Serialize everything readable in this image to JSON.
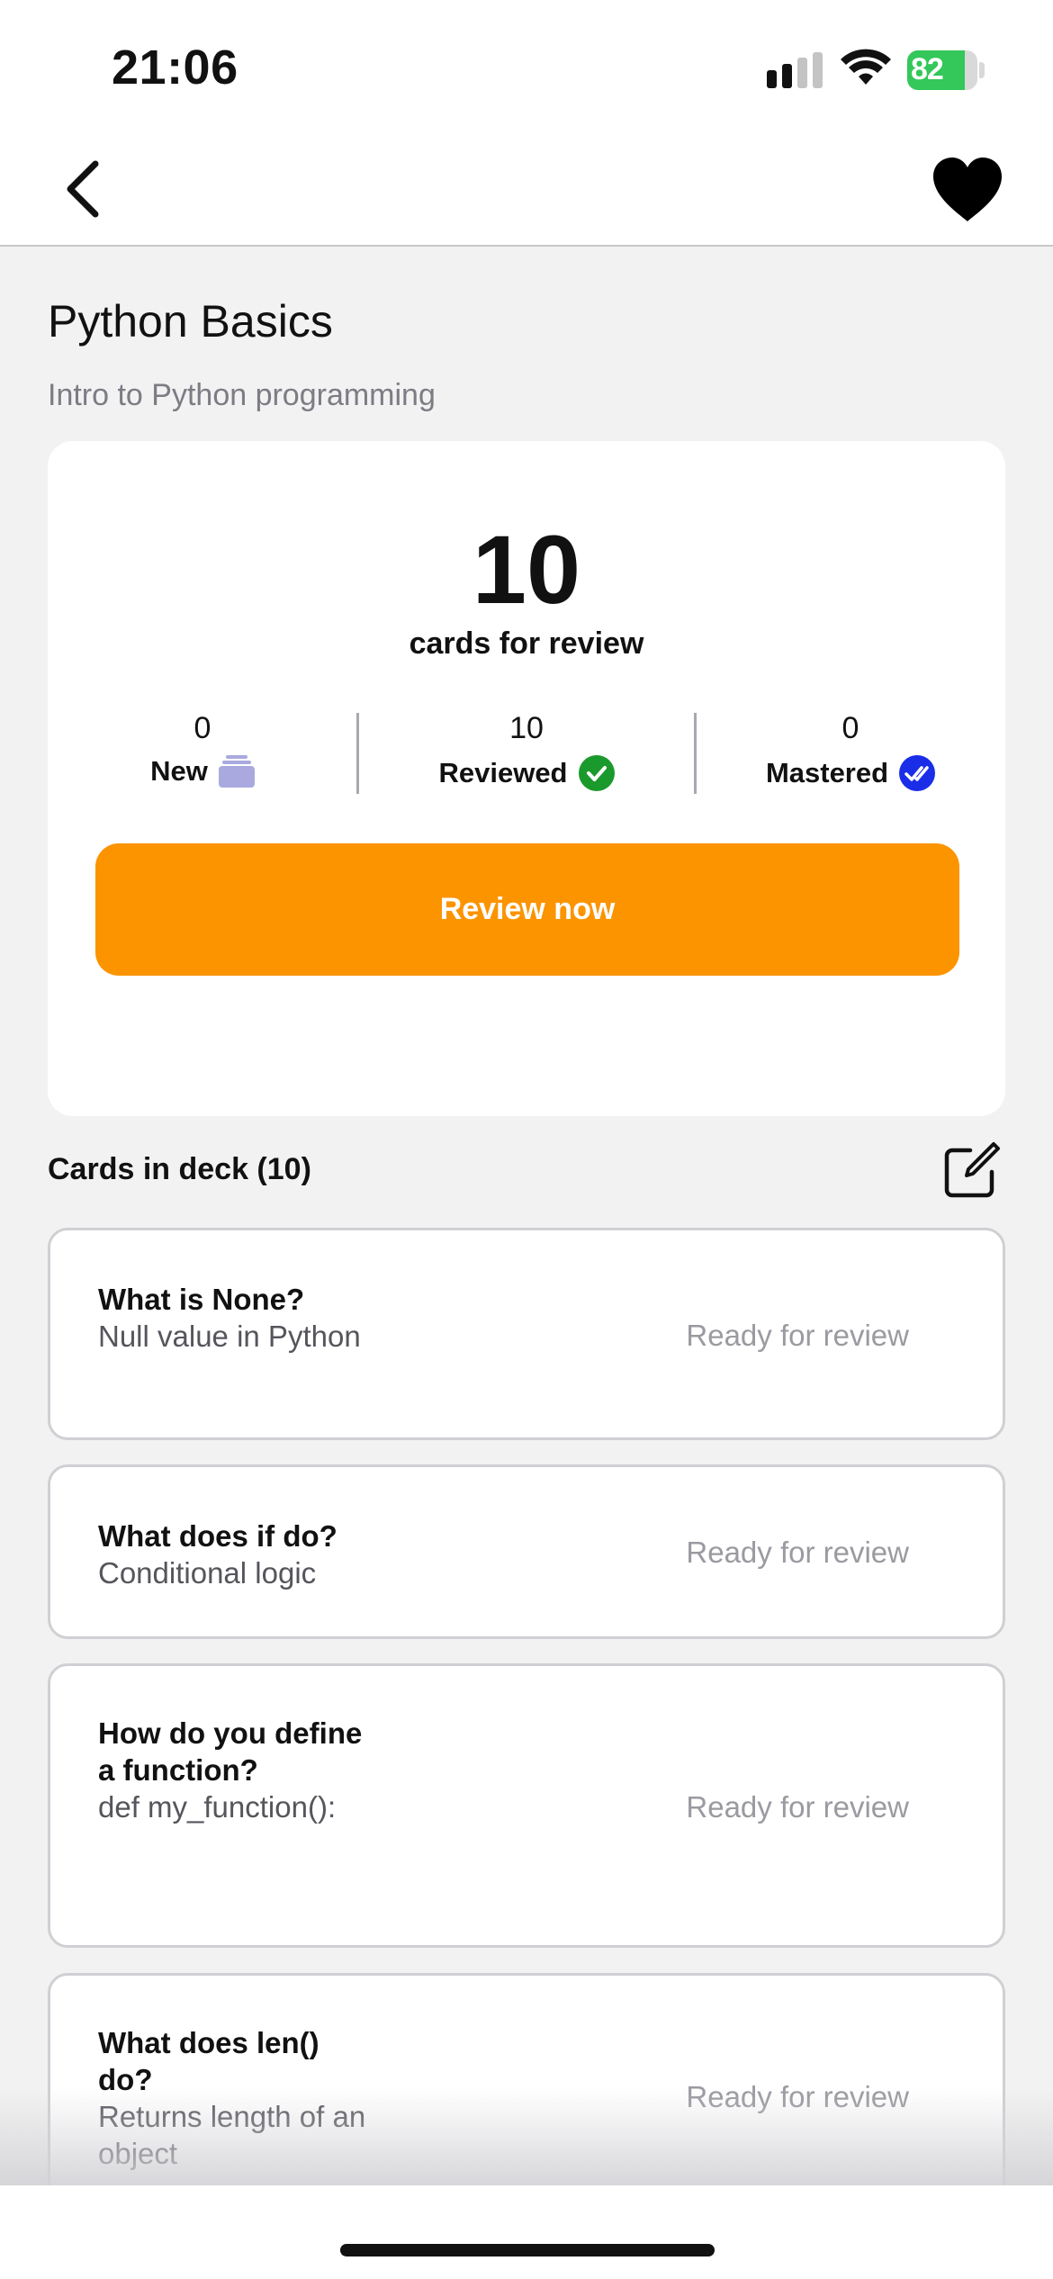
{
  "status_bar": {
    "time": "21:06",
    "battery_percent": "82",
    "battery_level": 0.82,
    "battery_color": "#34c759",
    "icons": [
      "signal-icon",
      "wifi-icon",
      "battery-charging-icon"
    ]
  },
  "nav": {
    "back_icon": "chevron-left-icon",
    "favorite_icon": "heart-filled-icon"
  },
  "deck": {
    "title": "Python Basics",
    "subtitle": "Intro to Python programming"
  },
  "summary": {
    "review_count": "10",
    "review_label": "cards for review",
    "stats": [
      {
        "value": "0",
        "label": "New",
        "icon": "card-stack-icon",
        "icon_color": "#a9a9e0"
      },
      {
        "value": "10",
        "label": "Reviewed",
        "icon": "check-circle-icon",
        "icon_color": "#1a9a2c"
      },
      {
        "value": "0",
        "label": "Mastered",
        "icon": "double-check-icon",
        "icon_color": "#1a2ee8"
      }
    ],
    "button_label": "Review now",
    "button_color": "#fc9400"
  },
  "cards_section": {
    "title": "Cards in deck (10)",
    "edit_icon": "edit-icon"
  },
  "cards": [
    {
      "question": "What is None?",
      "answer": "Null value in Python",
      "status": "Ready for review"
    },
    {
      "question": "What does if do?",
      "answer": "Conditional logic",
      "status": "Ready for review"
    },
    {
      "question": "How do you define a function?",
      "answer": "def my_function():",
      "status": "Ready for review"
    },
    {
      "question": "What does len() do?",
      "answer": "Returns length of an object",
      "status": "Ready for review"
    }
  ]
}
